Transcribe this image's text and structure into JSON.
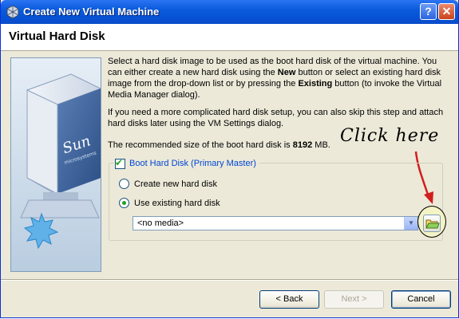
{
  "window": {
    "title": "Create New Virtual Machine",
    "help_label": "?",
    "close_label": "✕"
  },
  "header": {
    "title": "Virtual Hard Disk"
  },
  "content": {
    "para1_part1": "Select a hard disk image to be used as the boot hard disk of the virtual machine. You can either create a new hard disk using the ",
    "para1_new": "New",
    "para1_part2": " button or select an existing hard disk image from the drop-down list or by pressing the ",
    "para1_existing": "Existing",
    "para1_part3": " button (to invoke the Virtual Media Manager dialog).",
    "para2": "If you need a more complicated hard disk setup, you can also skip this step and attach hard disks later using the VM Settings dialog.",
    "recommend_prefix": "The recommended size of the boot hard disk is ",
    "recommend_value": "8192",
    "recommend_suffix": " MB."
  },
  "annotation": {
    "text": "Click here"
  },
  "group": {
    "checkbox_label": "Boot Hard Disk (Primary Master)",
    "checked": true,
    "create_label": "Create new hard disk",
    "existing_label": "Use existing hard disk",
    "selected_option": "existing",
    "media_value": "<no media>"
  },
  "artwork": {
    "brand_text": "Sun",
    "brand_subtext": "microsystems"
  },
  "buttons": {
    "back": "< Back",
    "next": "Next >",
    "cancel": "Cancel"
  },
  "colors": {
    "titlebar": "#0653d6",
    "legend_text": "#0046d5",
    "annotation_arrow": "#d21f1f",
    "ring_fill": "#f3f3c6"
  }
}
